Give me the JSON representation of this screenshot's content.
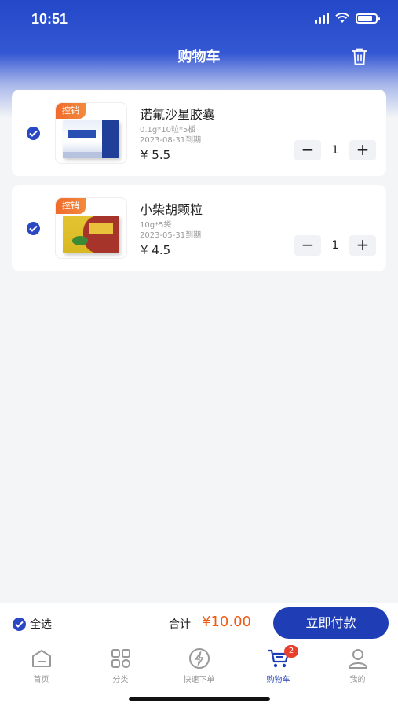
{
  "status_bar": {
    "time": "10:51"
  },
  "header": {
    "title": "购物车",
    "trash_icon": "trash-icon"
  },
  "cart_items": [
    {
      "badge": "控销",
      "name": "诺氟沙星胶囊",
      "spec": "0.1g*10粒*5板",
      "expiry": "2023-08-31到期",
      "price": "¥ 5.5",
      "quantity": "1",
      "minus": "−",
      "plus": "+"
    },
    {
      "badge": "控销",
      "name": "小柴胡颗粒",
      "spec": "10g*5袋",
      "expiry": "2023-05-31到期",
      "price": "¥ 4.5",
      "quantity": "1",
      "minus": "−",
      "plus": "+"
    }
  ],
  "footer": {
    "select_all_label": "全选",
    "total_label": "合计",
    "total_value": "¥10.00",
    "pay_button": "立即付款"
  },
  "tabbar": {
    "tabs": [
      {
        "label": "首页",
        "icon": "home-icon"
      },
      {
        "label": "分类",
        "icon": "category-icon"
      },
      {
        "label": "快速下单",
        "icon": "lightning-icon"
      },
      {
        "label": "购物车",
        "icon": "cart-icon",
        "badge": "2"
      },
      {
        "label": "我的",
        "icon": "user-icon"
      }
    ]
  },
  "colors": {
    "accent": "#1f3eb5",
    "price": "#f05a14",
    "badge": "#f06a2c"
  }
}
